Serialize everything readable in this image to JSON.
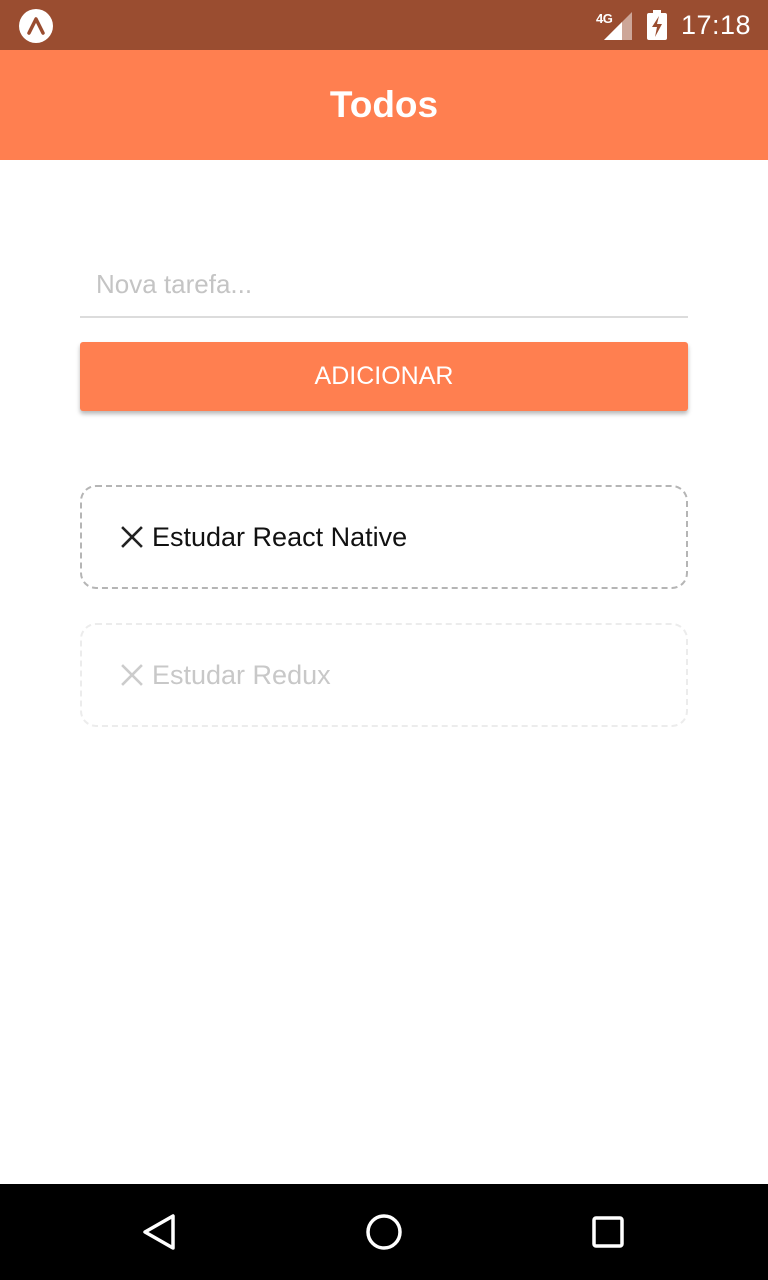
{
  "status_bar": {
    "network": "4G",
    "time": "17:18",
    "icons": [
      "app-logo-icon",
      "signal-icon",
      "battery-charging-icon"
    ]
  },
  "app_bar": {
    "title": "Todos"
  },
  "form": {
    "input_value": "",
    "input_placeholder": "Nova tarefa...",
    "add_label": "ADICIONAR"
  },
  "todos": [
    {
      "text": "Estudar React Native",
      "state": "active",
      "icon": "close-icon"
    },
    {
      "text": "Estudar Redux",
      "state": "faded",
      "icon": "close-icon"
    }
  ],
  "nav_bar": {
    "icons": [
      "back-icon",
      "home-icon",
      "recents-icon"
    ]
  },
  "colors": {
    "status_bar": "#9a4d30",
    "accent": "#ff7f50",
    "background": "#ffffff",
    "nav_bar": "#000000",
    "item_border": "#b5b5b5",
    "item_border_faded": "#ececec",
    "text_faded": "#c8c8c8"
  }
}
